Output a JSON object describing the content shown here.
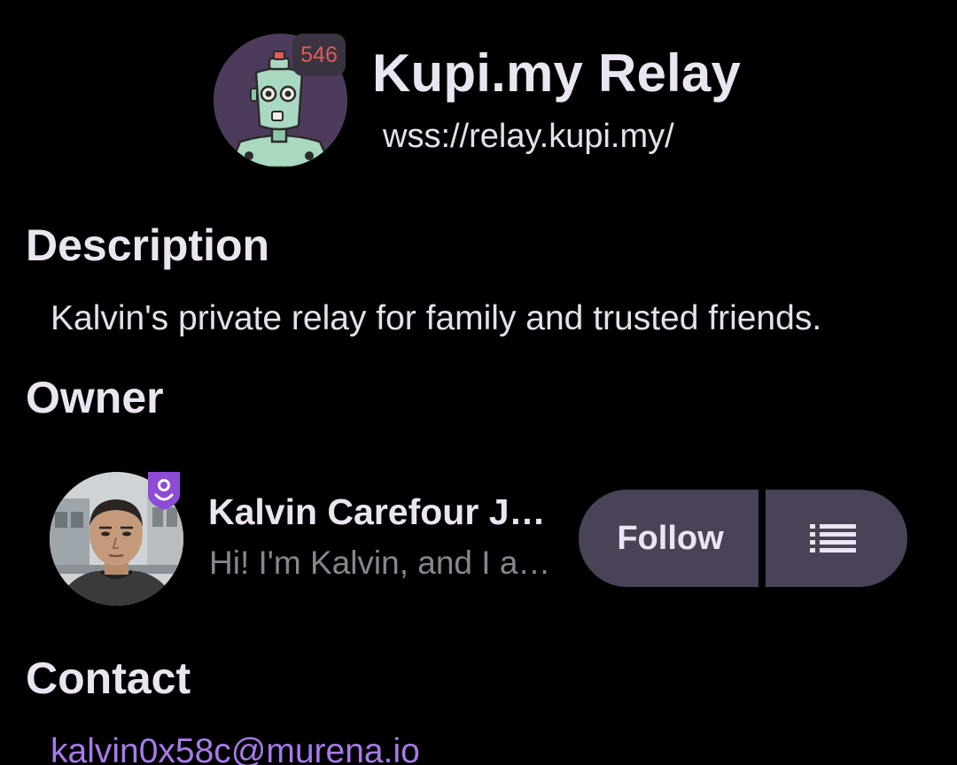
{
  "relay": {
    "name": "Kupi.my Relay",
    "url": "wss://relay.kupi.my/",
    "count_badge": "546",
    "icon": "robot-avatar"
  },
  "description": {
    "heading": "Description",
    "text": "Kalvin's private relay for family and trusted friends."
  },
  "owner": {
    "heading": "Owner",
    "name": "Kalvin Carefour J…",
    "bio": "Hi! I'm Kalvin, and I a…",
    "verified_icon": "verified-shield-icon",
    "follow_label": "Follow",
    "list_icon": "list-icon"
  },
  "contact": {
    "heading": "Contact",
    "email": "kalvin0x58c@murena.io"
  },
  "colors": {
    "background": "#000000",
    "text": "#ebe5f1",
    "muted_text": "#8a8490",
    "button_bg": "#4a4358",
    "link": "#a77be8",
    "badge_text": "#e05a5a",
    "verified": "#8e4bd6"
  }
}
